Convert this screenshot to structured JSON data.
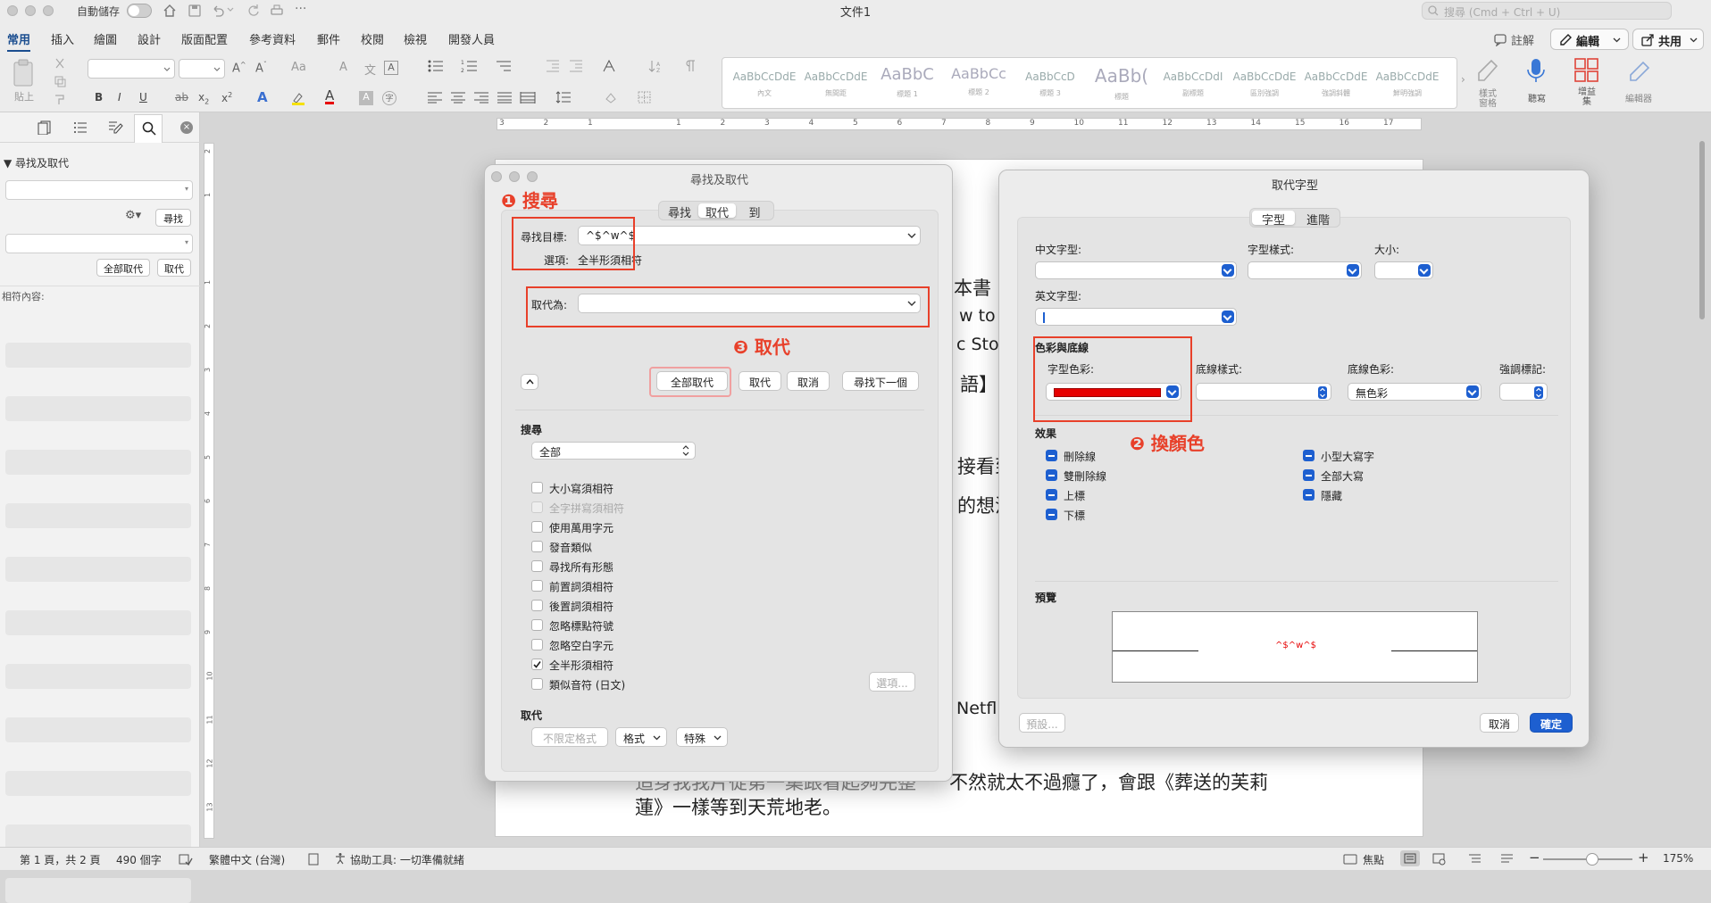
{
  "titlebar": {
    "autosave_label": "自動儲存",
    "doc_title": "文件1",
    "search_placeholder": "搜尋 (Cmd + Ctrl + U)"
  },
  "ribbon_tabs": [
    "常用",
    "插入",
    "繪圖",
    "設計",
    "版面配置",
    "參考資料",
    "郵件",
    "校閱",
    "檢視",
    "開發人員"
  ],
  "ribbon_buttons": {
    "comment": "註解",
    "edit": "編輯",
    "share": "共用"
  },
  "ribbon": {
    "paste": "貼上",
    "styles": [
      {
        "sample": "AaBbCcDdE",
        "name": "內文"
      },
      {
        "sample": "AaBbCcDdE",
        "name": "無間距"
      },
      {
        "sample": "AaBbC",
        "name": "標題 1"
      },
      {
        "sample": "AaBbCc",
        "name": "標題 2"
      },
      {
        "sample": "AaBbCcD",
        "name": "標題 3"
      },
      {
        "sample": "AaBb(",
        "name": "標題"
      },
      {
        "sample": "AaBbCcDdI",
        "name": "副標題"
      },
      {
        "sample": "AaBbCcDdE",
        "name": "區別強調"
      },
      {
        "sample": "AaBbCcDdE",
        "name": "強調斜體"
      },
      {
        "sample": "AaBbCcDdE",
        "name": "鮮明強調"
      }
    ],
    "style_pane": "樣式\n窗格",
    "dictate": "聽寫",
    "addins": "增益\n集",
    "editor": "編輯器"
  },
  "left_panel": {
    "header": "尋找及取代",
    "find_button": "尋找",
    "replace_all_button": "全部取代",
    "replace_button": "取代",
    "matches_label": "相符內容:"
  },
  "ruler_numbers": [
    "3",
    "2",
    "1",
    "",
    "1",
    "2",
    "3",
    "4",
    "5",
    "6",
    "7",
    "8",
    "9",
    "10",
    "11",
    "12",
    "13",
    "14",
    "15",
    "16",
    "17"
  ],
  "vruler_numbers": [
    "2",
    "1",
    "",
    "1",
    "2",
    "3",
    "4",
    "5",
    "6",
    "7",
    "8",
    "9",
    "10",
    "11",
    "12",
    "13"
  ],
  "document": {
    "frag1": "本書",
    "frag2": "w to W",
    "frag3": "c Stor",
    "frag4": "語】",
    "frag5": "接看到",
    "frag6": "的想法",
    "frag7": "Netfli",
    "line_a1": "追身我我片從第一集跟看起夠完整",
    "line_a2": "不然就太不過癮了，會跟《葬送的芙莉",
    "line_b": "蓮》一樣等到天荒地老。"
  },
  "find_dialog": {
    "title": "尋找及取代",
    "tabs": [
      "尋找",
      "取代",
      "到"
    ],
    "active_tab": "取代",
    "find_label": "尋找目標:",
    "find_value": "^$^w^$",
    "options_label": "選項:",
    "options_value": "全半形須相符",
    "replace_label": "取代為:",
    "replace_value": "",
    "buttons": {
      "replace_all": "全部取代",
      "replace": "取代",
      "cancel": "取消",
      "find_next": "尋找下一個"
    },
    "search_section": "搜尋",
    "search_scope": "全部",
    "checkboxes": [
      {
        "label": "大小寫須相符",
        "checked": false,
        "disabled": false
      },
      {
        "label": "全字拼寫須相符",
        "checked": false,
        "disabled": true
      },
      {
        "label": "使用萬用字元",
        "checked": false,
        "disabled": false
      },
      {
        "label": "發音類似",
        "checked": false,
        "disabled": false
      },
      {
        "label": "尋找所有形態",
        "checked": false,
        "disabled": false
      },
      {
        "label": "前置詞須相符",
        "checked": false,
        "disabled": false
      },
      {
        "label": "後置詞須相符",
        "checked": false,
        "disabled": false
      },
      {
        "label": "忽略標點符號",
        "checked": false,
        "disabled": false
      },
      {
        "label": "忽略空白字元",
        "checked": false,
        "disabled": false
      },
      {
        "label": "全半形須相符",
        "checked": true,
        "disabled": false
      },
      {
        "label": "類似音符 (日文)",
        "checked": false,
        "disabled": false
      }
    ],
    "options_button": "選項...",
    "replace_section": "取代",
    "no_format": "不限定格式",
    "format": "格式",
    "special": "特殊"
  },
  "annotations": {
    "a1": "❶ 搜尋",
    "a2": "❷ 換顏色",
    "a3": "❸ 取代",
    "color": "#e8402a"
  },
  "font_dialog": {
    "title": "取代字型",
    "tabs": [
      "字型",
      "進階"
    ],
    "active_tab": "字型",
    "cn_font": "中文字型:",
    "font_style": "字型樣式:",
    "size": "大小:",
    "en_font": "英文字型:",
    "color_section": "色彩與底線",
    "font_color": "字型色彩:",
    "font_color_value": "#e60000",
    "underline_style": "底線樣式:",
    "underline_color": "底線色彩:",
    "underline_color_value": "無色彩",
    "emphasis": "強調標記:",
    "effects_section": "效果",
    "effects_left": [
      "刪除線",
      "雙刪除線",
      "上標",
      "下標"
    ],
    "effects_right": [
      "小型大寫字",
      "全部大寫",
      "隱藏"
    ],
    "preview_section": "預覽",
    "preview_text": "^$^w^$",
    "default_button": "預設...",
    "cancel_button": "取消",
    "ok_button": "確定"
  },
  "status_bar": {
    "pages": "第 1 頁，共 2 頁",
    "words": "490 個字",
    "language": "繁體中文 (台灣)",
    "accessibility": "協助工具: 一切準備就緒",
    "focus": "焦點",
    "zoom": "175%"
  }
}
